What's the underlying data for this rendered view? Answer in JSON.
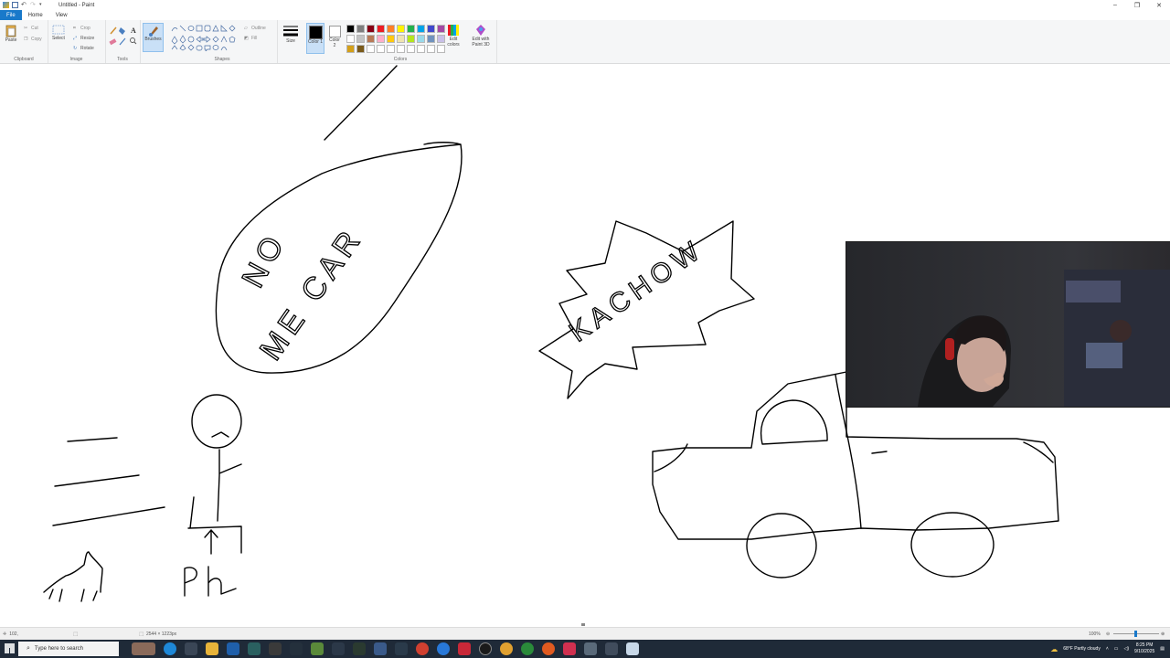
{
  "window": {
    "title": "Untitled - Paint"
  },
  "menu": {
    "file": "File",
    "home": "Home",
    "view": "View"
  },
  "ribbon": {
    "clipboard": {
      "label": "Clipboard",
      "paste": "Paste",
      "cut": "Cut",
      "copy": "Copy"
    },
    "image": {
      "label": "Image",
      "select": "Select",
      "crop": "Crop",
      "resize": "Resize",
      "rotate": "Rotate"
    },
    "tools": {
      "label": "Tools",
      "text_tool": "A"
    },
    "brushes": {
      "label": "Brushes"
    },
    "shapes": {
      "label": "Shapes",
      "outline": "Outline",
      "fill": "Fill"
    },
    "size": {
      "label": "Size"
    },
    "colors": {
      "label": "Colors",
      "color1": "Color 1",
      "color2": "Color 2",
      "edit_colors": "Edit colors",
      "edit_paint3d": "Edit with Paint 3D",
      "color1_value": "#000000",
      "color2_value": "#ffffff",
      "palette": [
        "#000000",
        "#7f7f7f",
        "#880015",
        "#ed1c24",
        "#ff7f27",
        "#fff200",
        "#22b14c",
        "#00a2e8",
        "#3f48cc",
        "#a349a4",
        "#ffffff",
        "#c3c3c3",
        "#b97a57",
        "#ffaec9",
        "#ffc90e",
        "#efe4b0",
        "#b5e61d",
        "#99d9ea",
        "#7092be",
        "#c8bfe7",
        "#d4a019",
        "#7a5a1a",
        "#ffffff",
        "#ffffff",
        "#ffffff",
        "#ffffff",
        "#ffffff",
        "#ffffff",
        "#ffffff",
        "#ffffff"
      ]
    }
  },
  "drawing_text": {
    "no": "NO",
    "me_car": "ME CAR",
    "kachow": "KACHOW",
    "pk": "PK"
  },
  "status": {
    "cursor": "102,",
    "dimensions": "2544 × 1223px",
    "zoom": "100%"
  },
  "taskbar": {
    "search_placeholder": "Type here to search",
    "weather": "68°F  Partly cloudy",
    "time": "8:25 PM",
    "date": "9/10/2025"
  }
}
